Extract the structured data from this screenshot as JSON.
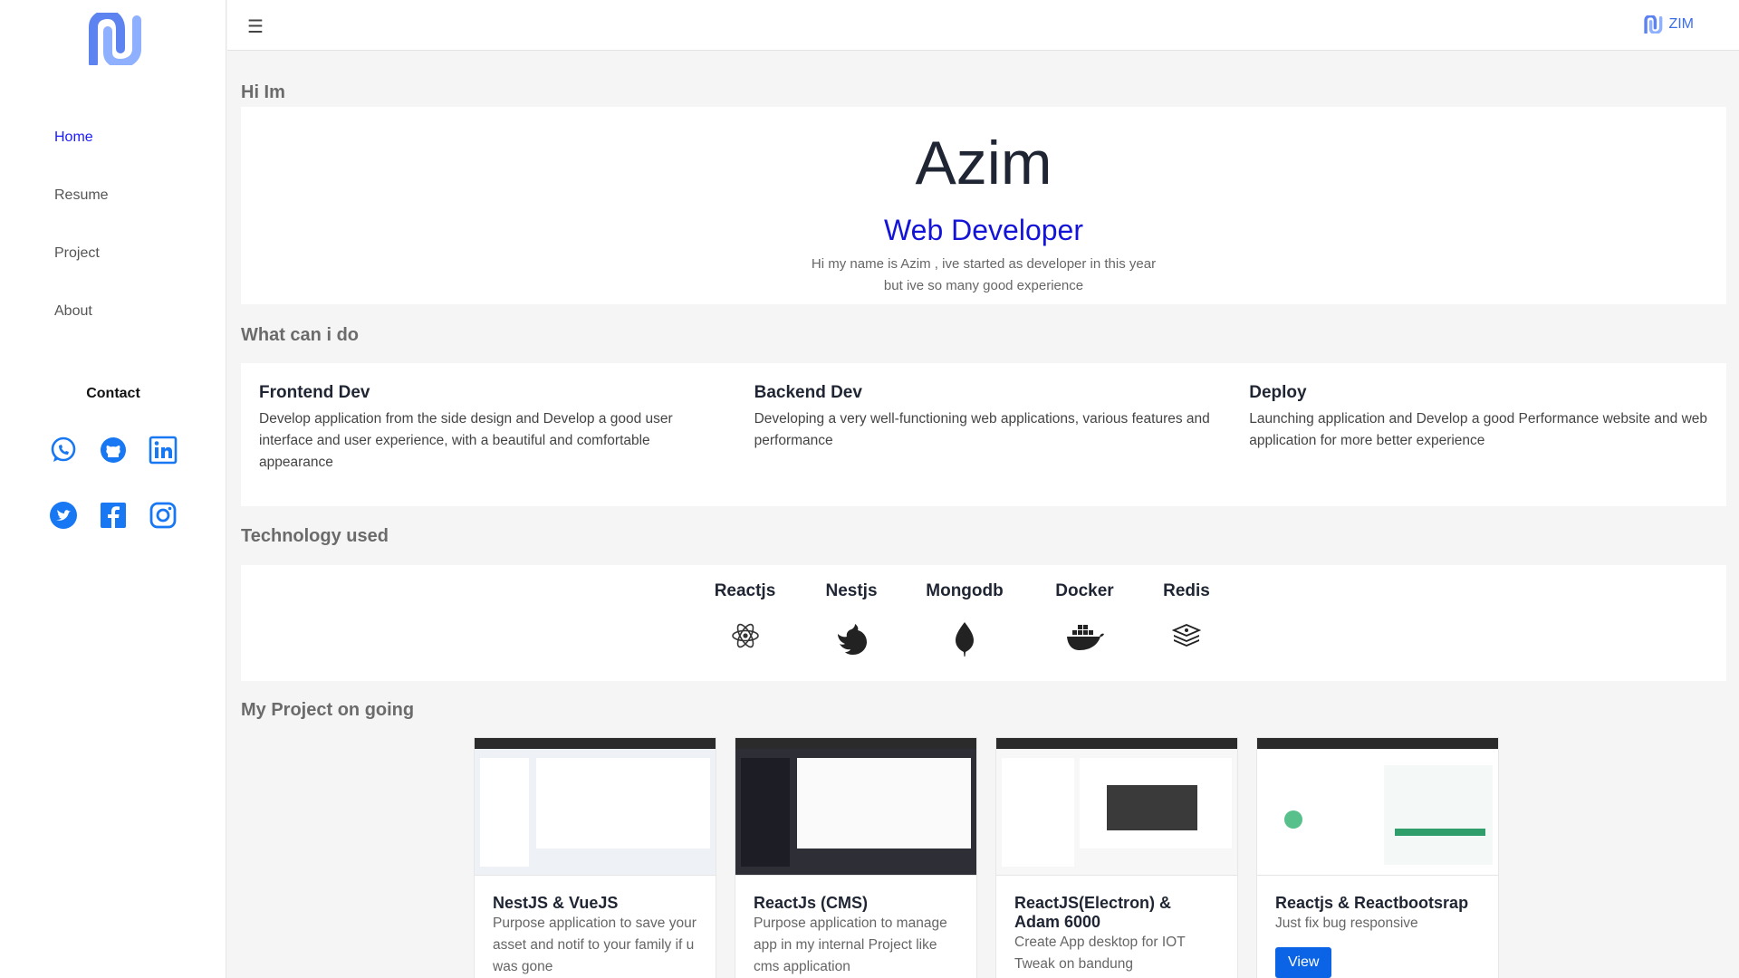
{
  "nav": {
    "items": [
      "Home",
      "Resume",
      "Project",
      "About"
    ],
    "active": "Home"
  },
  "contact": {
    "title": "Contact",
    "icons": [
      "whatsapp-icon",
      "github-icon",
      "linkedin-icon",
      "twitter-icon",
      "facebook-icon",
      "instagram-icon"
    ]
  },
  "header": {
    "menu_icon": "☰",
    "brand": "ZIM"
  },
  "hero": {
    "section_title": "Hi Im",
    "name": "Azim",
    "role": "Web Developer",
    "desc_line1": "Hi my name is Azim , ive started as developer in this year",
    "desc_line2": "but ive so many good experience"
  },
  "skills": {
    "section_title": "What can i do",
    "items": [
      {
        "title": "Frontend Dev",
        "desc": "Develop application from the side design and Develop a good user interface and user experience, with a beautiful and comfortable appearance"
      },
      {
        "title": "Backend Dev",
        "desc": "Developing a very well-functioning web applications, various features and performance"
      },
      {
        "title": "Deploy",
        "desc": "Launching application and Develop a good Performance website and web application for more better experience"
      }
    ]
  },
  "tech": {
    "section_title": "Technology used",
    "items": [
      "Reactjs",
      "Nestjs",
      "Mongodb",
      "Docker",
      "Redis"
    ]
  },
  "projects": {
    "section_title": "My Project on going",
    "items": [
      {
        "title": "NestJS & VueJS",
        "desc": "Purpose application to save your asset and notif to your family if u was gone"
      },
      {
        "title": "ReactJs (CMS)",
        "desc": "Purpose application to manage app in my internal Project like cms application"
      },
      {
        "title": "ReactJS(Electron) & Adam 6000",
        "desc": "Create App desktop for IOT Tweak on bandung"
      },
      {
        "title": "Reactjs & Reactbootsrap",
        "desc": "Just fix bug responsive",
        "button": "View"
      }
    ]
  },
  "colors": {
    "accent": "#1414d8",
    "button": "#0b64e6",
    "social": "#1877f2"
  }
}
